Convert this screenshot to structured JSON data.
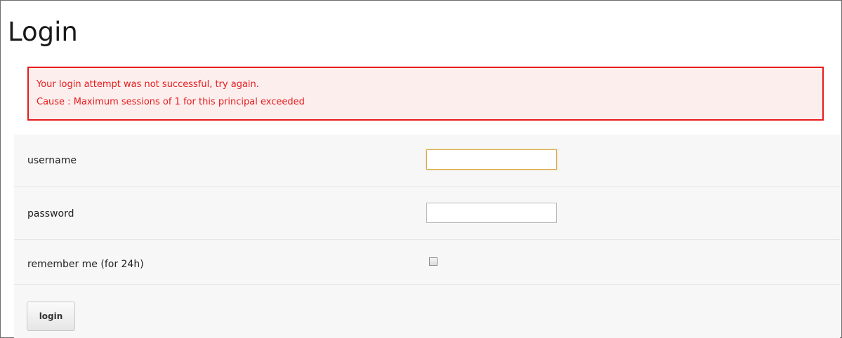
{
  "page": {
    "title": "Login"
  },
  "error": {
    "line1": "Your login attempt was not successful, try again.",
    "line2": "Cause : Maximum sessions of 1 for this principal exceeded",
    "color": "#e61b1b",
    "background": "#fdeeee"
  },
  "form": {
    "username": {
      "label": "username",
      "value": "",
      "focused": true
    },
    "password": {
      "label": "password",
      "value": ""
    },
    "remember": {
      "label": "remember me (for 24h)",
      "checked": false
    },
    "submit_label": "login"
  }
}
